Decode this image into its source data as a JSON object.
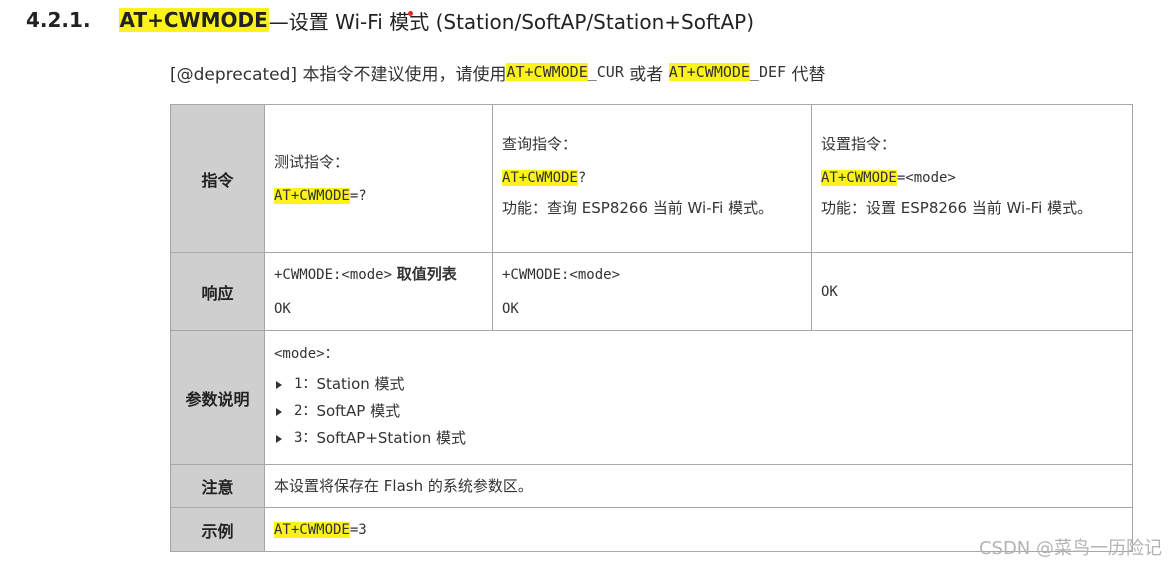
{
  "heading": {
    "number": "4.2.1.",
    "command": "AT+CWMODE",
    "title_rest": "—设置 Wi-Fi 模式 (Station/SoftAP/Station+SoftAP)"
  },
  "deprecated": {
    "prefix": "[@deprecated] 本指令不建议使用，请使用 ",
    "cmd1": "AT+CWMODE",
    "suffix1": "_CUR",
    "middle": " 或者 ",
    "cmd2": "AT+CWMODE",
    "suffix2": "_DEF",
    "end": " 代替"
  },
  "table": {
    "command_row": {
      "label": "指令",
      "test": {
        "title": "测试指令：",
        "cmd": "AT+CWMODE",
        "suffix": "=?"
      },
      "query": {
        "title": "查询指令：",
        "cmd": "AT+CWMODE",
        "suffix": "?",
        "desc": "功能：查询 ESP8266 当前 Wi-Fi 模式。"
      },
      "set": {
        "title": "设置指令：",
        "cmd": "AT+CWMODE",
        "suffix": "=<mode>",
        "desc": "功能：设置 ESP8266 当前 Wi-Fi 模式。"
      }
    },
    "response_row": {
      "label": "响应",
      "test": {
        "line1": "+CWMODE:<mode>",
        "line1_bold": "取值列表",
        "line2": "OK"
      },
      "query": {
        "line1": "+CWMODE:<mode>",
        "line2": "OK"
      },
      "set": {
        "line1": "OK"
      }
    },
    "param_row": {
      "label": "参数说明",
      "intro": "<mode>：",
      "items": [
        {
          "num": "1：",
          "text": "Station 模式"
        },
        {
          "num": "2：",
          "text": "SoftAP 模式"
        },
        {
          "num": "3：",
          "text": "SoftAP+Station 模式"
        }
      ]
    },
    "note_row": {
      "label": "注意",
      "text": "本设置将保存在 Flash 的系统参数区。"
    },
    "example_row": {
      "label": "示例",
      "cmd": "AT+CWMODE",
      "suffix": "=3"
    }
  },
  "watermark": "CSDN @菜鸟一历险记",
  "colors": {
    "highlight": "#fdf31b",
    "header_cell": "#cfcfcf",
    "border": "#a6a6a6",
    "marker_dot": "#e0281d"
  }
}
